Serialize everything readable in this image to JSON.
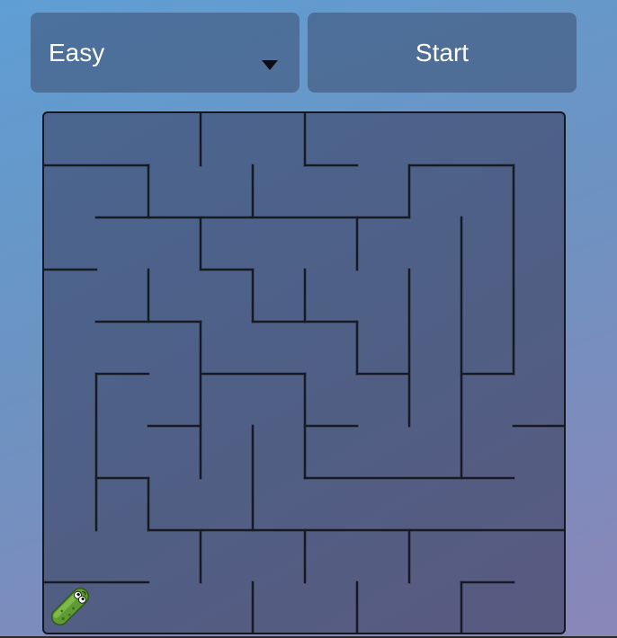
{
  "controls": {
    "difficulty": {
      "selected": "Easy",
      "options": [
        "Easy"
      ]
    },
    "start_label": "Start"
  },
  "maze": {
    "grid_size": 10,
    "colors": {
      "wall": "#171a22",
      "player": "#6fae3b"
    },
    "walls": [
      [
        3,
        0,
        3,
        1
      ],
      [
        5,
        0,
        5,
        1
      ],
      [
        5,
        1,
        6,
        1
      ],
      [
        0,
        1,
        2,
        1
      ],
      [
        2,
        1,
        2,
        2
      ],
      [
        4,
        1,
        4,
        2
      ],
      [
        7,
        1,
        9,
        1
      ],
      [
        7,
        1,
        7,
        2
      ],
      [
        9,
        1,
        9,
        5
      ],
      [
        1,
        2,
        7,
        2
      ],
      [
        3,
        2,
        3,
        3
      ],
      [
        6,
        2,
        6,
        3
      ],
      [
        8,
        2,
        8,
        7
      ],
      [
        0,
        3,
        1,
        3
      ],
      [
        3,
        3,
        4,
        3
      ],
      [
        4,
        3,
        4,
        4
      ],
      [
        5,
        3,
        5,
        4
      ],
      [
        7,
        3,
        7,
        6
      ],
      [
        2,
        3,
        2,
        4
      ],
      [
        1,
        4,
        3,
        4
      ],
      [
        4,
        4,
        6,
        4
      ],
      [
        6,
        4,
        6,
        5
      ],
      [
        6,
        5,
        7,
        5
      ],
      [
        8,
        5,
        9,
        5
      ],
      [
        3,
        4,
        3,
        7
      ],
      [
        1,
        5,
        1,
        8
      ],
      [
        1,
        5,
        2,
        5
      ],
      [
        3,
        5,
        5,
        5
      ],
      [
        5,
        5,
        5,
        7
      ],
      [
        2,
        6,
        3,
        6
      ],
      [
        5,
        6,
        6,
        6
      ],
      [
        9,
        6,
        10,
        6
      ],
      [
        4,
        6,
        4,
        8
      ],
      [
        1,
        7,
        2,
        7
      ],
      [
        2,
        7,
        2,
        8
      ],
      [
        5,
        7,
        9,
        7
      ],
      [
        2,
        8,
        10,
        8
      ],
      [
        3,
        8,
        3,
        9
      ],
      [
        5,
        8,
        5,
        9
      ],
      [
        7,
        8,
        7,
        9
      ],
      [
        0,
        9,
        2,
        9
      ],
      [
        4,
        9,
        4,
        10
      ],
      [
        6,
        9,
        6,
        10
      ],
      [
        8,
        9,
        9,
        9
      ],
      [
        8,
        9,
        8,
        10
      ]
    ],
    "player": {
      "icon": "pickle-icon",
      "cell": [
        0,
        9
      ]
    }
  }
}
